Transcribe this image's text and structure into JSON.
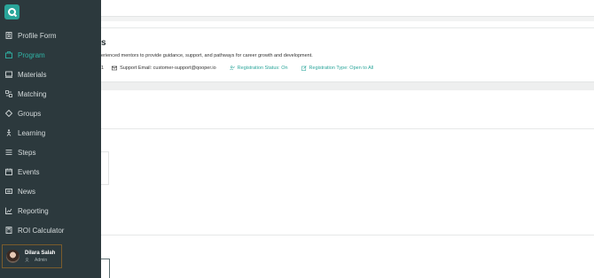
{
  "sidebar": {
    "logo_icon": "q-logo-icon",
    "items": [
      {
        "label": "Profile Form",
        "icon": "profile-form-icon",
        "active": false
      },
      {
        "label": "Program",
        "icon": "program-icon",
        "active": true
      },
      {
        "label": "Materials",
        "icon": "materials-icon",
        "active": false
      },
      {
        "label": "Matching",
        "icon": "matching-icon",
        "active": false
      },
      {
        "label": "Groups",
        "icon": "groups-icon",
        "active": false
      },
      {
        "label": "Learning",
        "icon": "learning-icon",
        "active": false
      },
      {
        "label": "Steps",
        "icon": "steps-icon",
        "active": false
      },
      {
        "label": "Events",
        "icon": "events-icon",
        "active": false
      },
      {
        "label": "News",
        "icon": "news-icon",
        "active": false
      },
      {
        "label": "Reporting",
        "icon": "reporting-icon",
        "active": false
      },
      {
        "label": "ROI Calculator",
        "icon": "calculator-icon",
        "active": false
      }
    ],
    "user": {
      "name": "Dilara Salah",
      "role": "Admin",
      "role_icon": "user-icon"
    },
    "colors": {
      "background": "#2c393d",
      "active": "#2fb4a6",
      "text": "#d4dadb"
    }
  },
  "main": {
    "heading_fragment": "s",
    "description_fragment": "erienced mentors to provide guidance, support, and pathways for career growth and development.",
    "meta": {
      "leading_fragment": "1",
      "support_email": "Support Email: customer-support@qooper.io",
      "registration_status": "Registration Status: On",
      "registration_type": "Registration Type: Open to All"
    },
    "colors": {
      "accent": "#2aa59a"
    }
  }
}
